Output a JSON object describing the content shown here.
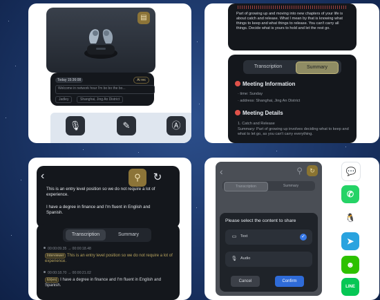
{
  "panel_recorder": {
    "record_card": {
      "date": "Today 15:36:08",
      "badge": "Ai rec",
      "preview_text": "Welcome in network hour I'm bo bo the bo...",
      "chip_speaker": "Jadley",
      "chip_location": "Shanghai, Jing An District"
    },
    "toolbar": {
      "mic_icon": "microphone-icon",
      "recorder_icon": "voice-recorder-icon",
      "translate_icon": "translate-icon"
    }
  },
  "panel_summary": {
    "excerpt": "Part of growing up and moving into new chapters of your life is about catch and release. What I mean by that is knowing what things to keep and what things to release. You can't carry all things. Decide what is yours to hold and let the rest go.",
    "tabs": [
      "Transcription",
      "Summary"
    ],
    "active_tab": "Summary",
    "meeting_information": {
      "title": "Meeting Information",
      "time": "· time: Sunday",
      "address": "· address: Shanghai, Jing An District"
    },
    "meeting_details": {
      "title": "Meeting Details",
      "item": "1. Catch and Release",
      "summary": "Summary: Part of growing up involves deciding what to keep and what to let go, as you can't carry everything."
    }
  },
  "panel_transcription": {
    "excerpt_1": "This is an entry level position so we do not require a lot of experience.",
    "excerpt_2": "I have a degree in finance and I'm fluent in English and Spanish.",
    "tabs": [
      "Transcription",
      "Summary"
    ],
    "active_tab": "Transcription",
    "entries": [
      {
        "time": "00:00:09.35 → 00:00:18.48",
        "speaker": "Interviewer",
        "text": "This is an entry level position so we do not require a lot of experience."
      },
      {
        "time": "00:00:18.70 → 00:00:21.02",
        "speaker": "Eli(en)",
        "text": "I have a degree in finance and I'm fluent in English and Spanish."
      }
    ]
  },
  "panel_share": {
    "tabs": [
      "Transcription",
      "Summary"
    ],
    "dialog": {
      "title": "Please select the content to share",
      "option_text": "Text",
      "option_audio": "Audio",
      "cancel": "Cancel",
      "confirm": "Confirm"
    },
    "apps": [
      "Messages",
      "WhatsApp",
      "QQ",
      "Telegram",
      "WeChat",
      "LINE"
    ],
    "app_colors": [
      "#ffffff",
      "#25d366",
      "#ffffff",
      "#2aa3df",
      "#2dc100",
      "#06c755"
    ]
  }
}
